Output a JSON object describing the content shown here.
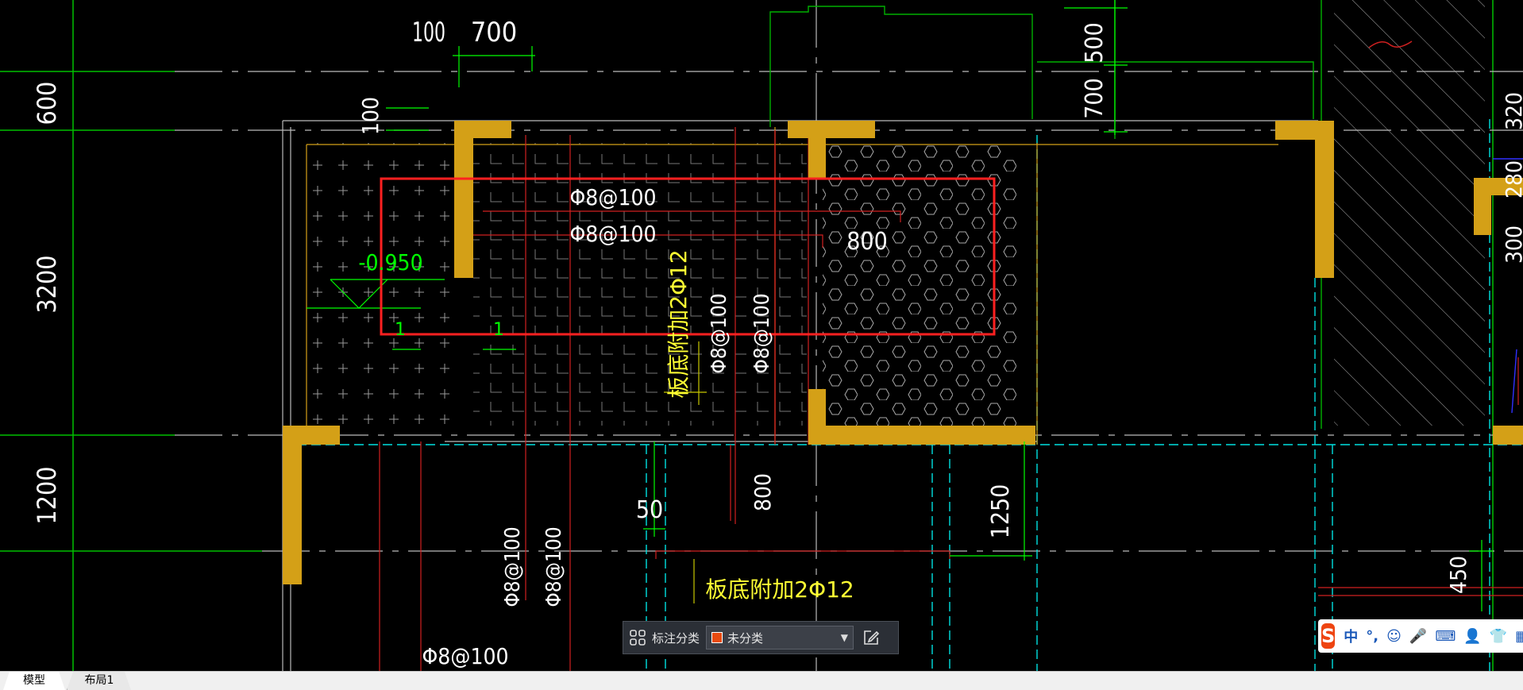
{
  "drawing": {
    "dims": {
      "d100_top": "100",
      "d700_top": "700",
      "d600_left": "600",
      "d3200_left": "3200",
      "d1200_left": "1200",
      "d100_small": "100",
      "d500_right": "500",
      "d700_right": "700",
      "d800_mid": "800",
      "d800_vert": "800",
      "d50": "50",
      "d1250": "1250",
      "d450": "450",
      "d320_edge": "320",
      "d280_edge": "280",
      "d300_edge": "300"
    },
    "rebar": {
      "top1": "Φ8@100",
      "top2": "Φ8@100",
      "vert1": "Φ8@100",
      "vert2": "Φ8@100",
      "bottom_v1": "Φ8@100",
      "bottom_v2": "Φ8@100",
      "bottom_h": "Φ8@100",
      "add_vert": "板底附加2Φ12",
      "add_bottom": "板底附加2Φ12"
    },
    "elevation": "-0.950",
    "slope_label": "1",
    "slope_label2": "1"
  },
  "toolbar": {
    "label": "标注分类",
    "selected": "未分类",
    "swatch_color": "#e84a10",
    "left_icon": "grid-4-icon",
    "right_icon": "edit-icon"
  },
  "tabs": [
    {
      "label": "模型",
      "active": true
    },
    {
      "label": "布局1",
      "active": false
    }
  ],
  "ime": {
    "logo": "S",
    "items": [
      "中",
      "°,",
      "☺",
      "🎤",
      "⌨",
      "👤",
      "👕",
      "▦"
    ]
  },
  "colors": {
    "background": "#000000",
    "wall": "#d4a017",
    "selection": "#ff2020",
    "dimension": "#00ff00",
    "text_white": "#ffffff",
    "text_yellow": "#ffff33",
    "grid_line": "#00ffff"
  }
}
